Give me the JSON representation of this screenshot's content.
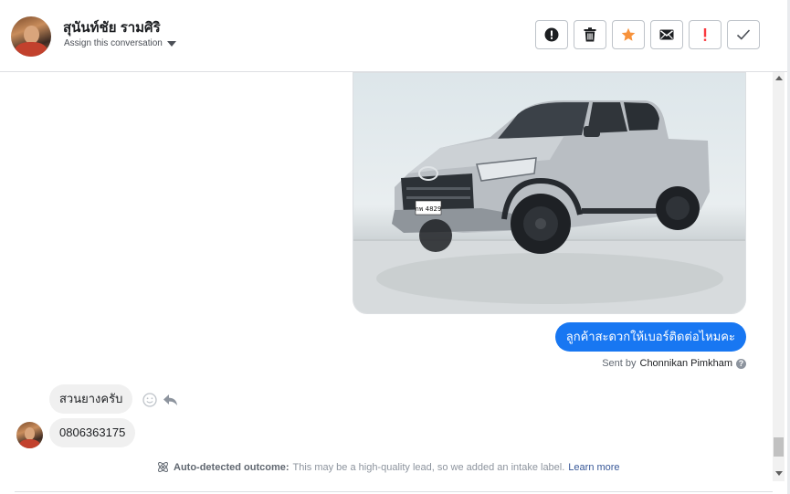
{
  "header": {
    "contact_name": "สุนันท์ชัย รามศิริ",
    "assign_label": "Assign this conversation",
    "actions": [
      {
        "name": "alert-icon",
        "label": "!"
      },
      {
        "name": "trash-icon"
      },
      {
        "name": "star-icon"
      },
      {
        "name": "mail-icon"
      },
      {
        "name": "important-icon",
        "label": "!"
      },
      {
        "name": "check-icon"
      }
    ]
  },
  "colors": {
    "accent_blue": "#1877f2",
    "star_orange": "#f7923b",
    "important_red": "#fa383e"
  },
  "conversation": {
    "image": {
      "plate": "กพ 4829"
    },
    "outgoing_message": "ลูกค้าสะดวกให้เบอร์ติดต่อไหมคะ",
    "sent_by_prefix": "Sent by",
    "sent_by_agent": "Chonnikan Pimkham",
    "help_icon": "?",
    "incoming_messages": [
      "สวนยางครับ",
      "0806363175"
    ]
  },
  "outcome": {
    "label": "Auto-detected outcome:",
    "text": "This may be a high-quality lead, so we added an intake label.",
    "link": "Learn more"
  }
}
